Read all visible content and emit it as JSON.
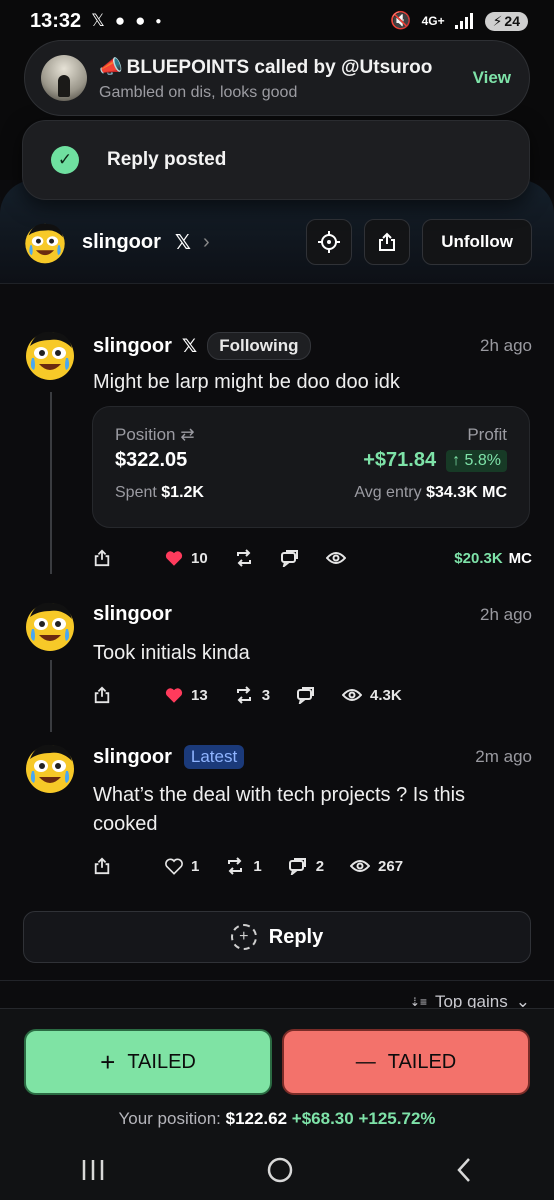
{
  "status_bar": {
    "time": "13:32",
    "network": "4G+",
    "battery": "24"
  },
  "notification": {
    "title": "BLUEPOINTS called by @Utsuroo",
    "subtitle": "Gambled on dis, looks good",
    "action": "View"
  },
  "toast": {
    "text": "Reply posted"
  },
  "header": {
    "name": "slingoor",
    "x_glyph": "𝕏",
    "chevron": "›",
    "unfollow_label": "Unfollow"
  },
  "posts": [
    {
      "name": "slingoor",
      "x_glyph": "𝕏",
      "badge": "Following",
      "time": "2h ago",
      "body": "Might be larp might be doo doo idk",
      "card": {
        "position_label": "Position",
        "swap_glyph": "⇄",
        "profit_label": "Profit",
        "position_value": "$322.05",
        "profit_value": "+$71.84",
        "profit_pct": "↑ 5.8%",
        "spent_label": "Spent",
        "spent_value": "$1.2K",
        "avg_label": "Avg entry",
        "avg_value": "$34.3K MC"
      },
      "likes": "10",
      "mc_value": "$20.3K",
      "mc_unit": "MC"
    },
    {
      "name": "slingoor",
      "time": "2h ago",
      "body": "Took initials kinda",
      "likes": "13",
      "reposts": "3",
      "views": "4.3K"
    },
    {
      "name": "slingoor",
      "badge": "Latest",
      "time": "2m ago",
      "body": "What’s the deal with tech projects ? Is this cooked",
      "likes": "1",
      "reposts": "1",
      "comments": "2",
      "views": "267"
    }
  ],
  "reply_button": {
    "label": "Reply",
    "icon": "+"
  },
  "sort": {
    "label": "Top gains",
    "icon": "⇣≡",
    "chevron": "⌄"
  },
  "trade": {
    "tail_buy_label": "TAILED",
    "tail_buy_symbol": "+",
    "tail_sell_label": "TAILED",
    "tail_sell_symbol": "—",
    "position_label": "Your position:",
    "position_value": "$122.62",
    "position_profit": "+$68.30",
    "position_pct": "+125.72%"
  },
  "colors": {
    "accent_green": "#7ee2a8",
    "accent_red": "#f3726b",
    "latest_blue": "#1b3a7a"
  },
  "icons": [
    "x-logo-icon",
    "target-icon",
    "share-icon",
    "heart-icon",
    "repost-icon",
    "comment-icon",
    "eye-icon",
    "check-icon",
    "megaphone-icon"
  ]
}
